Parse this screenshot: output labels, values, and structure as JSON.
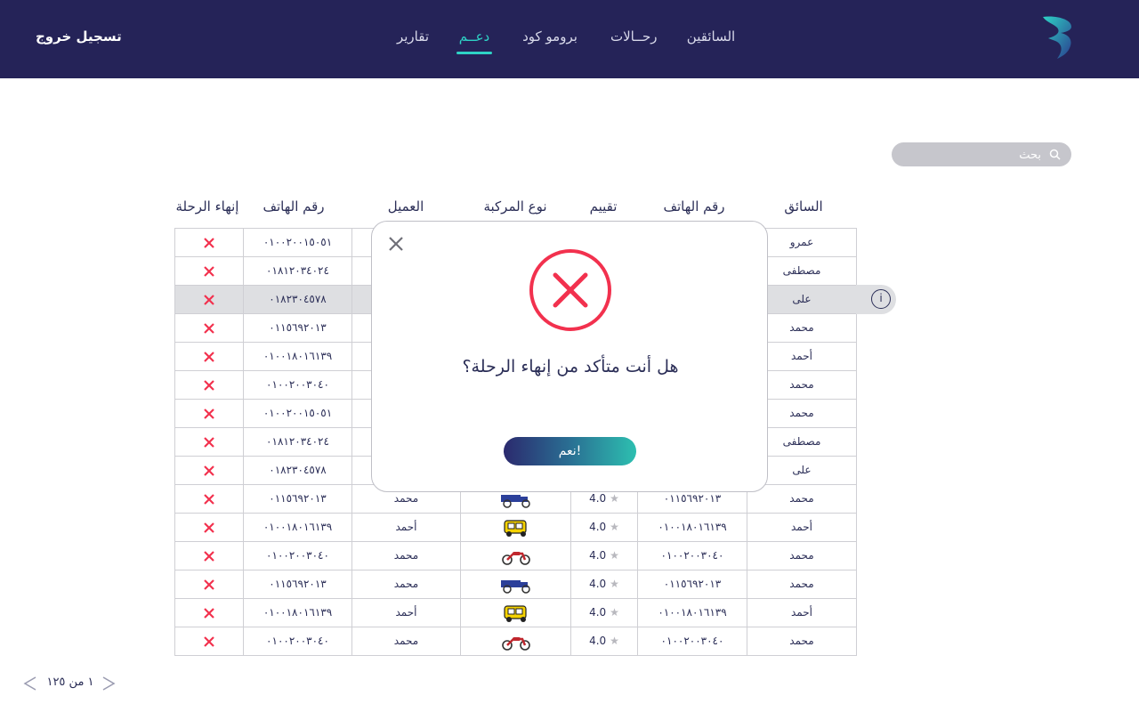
{
  "nav": {
    "logo": "app-logo",
    "items": [
      "السائقين",
      "رحــالات",
      "برومو كود",
      "دعــم",
      "تقارير"
    ],
    "logout": "تسجيل خروج"
  },
  "search": {
    "placeholder": "بحث"
  },
  "table": {
    "headers": [
      "السائق",
      "رقم الهاتف",
      "تقييم",
      "نوع المركبة",
      "العميل",
      "رقم الهاتف",
      "إنهاء الرحلة"
    ],
    "rows": [
      {
        "driver": "عمرو",
        "driver_phone": "",
        "rating": "",
        "vehicle": "",
        "client": "",
        "client_phone": "٠١٠٠٢٠٠١٥٠٥١"
      },
      {
        "driver": "مصطفى",
        "driver_phone": "",
        "rating": "",
        "vehicle": "",
        "client": "",
        "client_phone": "٠١٨١٢٠٣٤٠٢٤"
      },
      {
        "driver": "على",
        "driver_phone": "",
        "rating": "",
        "vehicle": "",
        "client": "",
        "client_phone": "٠١٨٢٣٠٤٥٧٨"
      },
      {
        "driver": "محمد",
        "driver_phone": "",
        "rating": "",
        "vehicle": "",
        "client": "",
        "client_phone": "٠١١٥٦٩٢٠١٣"
      },
      {
        "driver": "أحمد",
        "driver_phone": "",
        "rating": "",
        "vehicle": "",
        "client": "",
        "client_phone": "٠١٠٠١٨٠١٦١٣٩"
      },
      {
        "driver": "محمد",
        "driver_phone": "",
        "rating": "",
        "vehicle": "",
        "client": "",
        "client_phone": "٠١٠٠٢٠٠٣٠٤٠"
      },
      {
        "driver": "محمد",
        "driver_phone": "",
        "rating": "",
        "vehicle": "",
        "client": "",
        "client_phone": "٠١٠٠٢٠٠١٥٠٥١"
      },
      {
        "driver": "مصطفى",
        "driver_phone": "",
        "rating": "",
        "vehicle": "",
        "client": "",
        "client_phone": "٠١٨١٢٠٣٤٠٢٤"
      },
      {
        "driver": "على",
        "driver_phone": "",
        "rating": "",
        "vehicle": "",
        "client": "",
        "client_phone": "٠١٨٢٣٠٤٥٧٨"
      },
      {
        "driver": "محمد",
        "driver_phone": "٠١١٥٦٩٢٠١٣",
        "rating": "4.0",
        "vehicle": "truck-icon",
        "client": "محمد",
        "client_phone": "٠١١٥٦٩٢٠١٣"
      },
      {
        "driver": "أحمد",
        "driver_phone": "٠١٠٠١٨٠١٦١٣٩",
        "rating": "4.0",
        "vehicle": "tuktuk-icon",
        "client": "أحمد",
        "client_phone": "٠١٠٠١٨٠١٦١٣٩"
      },
      {
        "driver": "محمد",
        "driver_phone": "٠١٠٠٢٠٠٣٠٤٠",
        "rating": "4.0",
        "vehicle": "motorcycle-icon",
        "client": "محمد",
        "client_phone": "٠١٠٠٢٠٠٣٠٤٠"
      },
      {
        "driver": "محمد",
        "driver_phone": "٠١١٥٦٩٢٠١٣",
        "rating": "4.0",
        "vehicle": "truck-icon",
        "client": "محمد",
        "client_phone": "٠١١٥٦٩٢٠١٣"
      },
      {
        "driver": "أحمد",
        "driver_phone": "٠١٠٠١٨٠١٦١٣٩",
        "rating": "4.0",
        "vehicle": "tuktuk-icon",
        "client": "أحمد",
        "client_phone": "٠١٠٠١٨٠١٦١٣٩"
      },
      {
        "driver": "محمد",
        "driver_phone": "٠١٠٠٢٠٠٣٠٤٠",
        "rating": "4.0",
        "vehicle": "motorcycle-icon",
        "client": "محمد",
        "client_phone": "٠١٠٠٢٠٠٣٠٤٠"
      }
    ],
    "highlighted_row": 2
  },
  "pagination": {
    "text": "١ من ١٢٥"
  },
  "modal": {
    "message": "هل أنت متأكد من إنهاء الرحلة؟",
    "confirm": "نعم!",
    "icon": "error-x-icon"
  },
  "colors": {
    "header_bg": "#252358",
    "accent": "#2ed3c6",
    "danger": "#f2314e",
    "text": "#2b2e57"
  }
}
